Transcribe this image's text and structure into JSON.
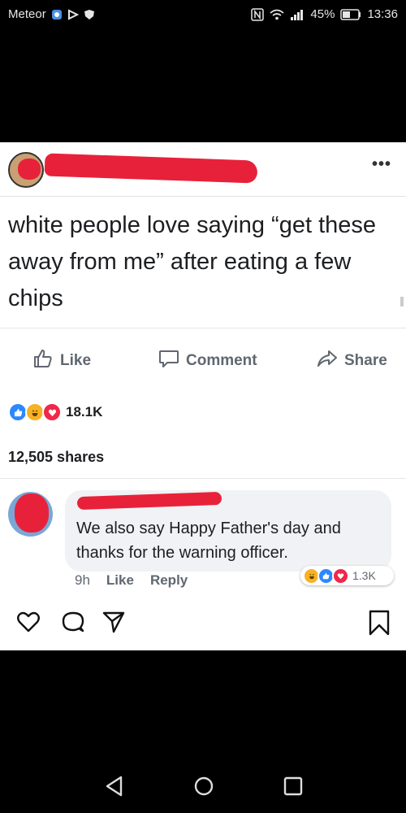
{
  "status_bar": {
    "carrier": "Meteor",
    "battery": "45%",
    "time": "13:36",
    "icons": [
      "app-notification-icon",
      "play-icon",
      "shield-icon",
      "nfc-icon",
      "wifi-icon",
      "signal-icon",
      "battery-icon"
    ]
  },
  "post": {
    "text": "white people love saying “get these away from me” after eating a few chips",
    "actions": {
      "like": "Like",
      "comment": "Comment",
      "share": "Share"
    },
    "reaction_count": "18.1K",
    "shares": "12,505 shares"
  },
  "comment": {
    "text": "We also say Happy Father's day and thanks for the warning officer.",
    "time": "9h",
    "like": "Like",
    "reply": "Reply",
    "reaction_count": "1.3K"
  },
  "colors": {
    "redaction": "#e8213a",
    "like_blue": "#2d88ff",
    "love_red": "#f02849",
    "haha_yellow": "#f7b125"
  }
}
